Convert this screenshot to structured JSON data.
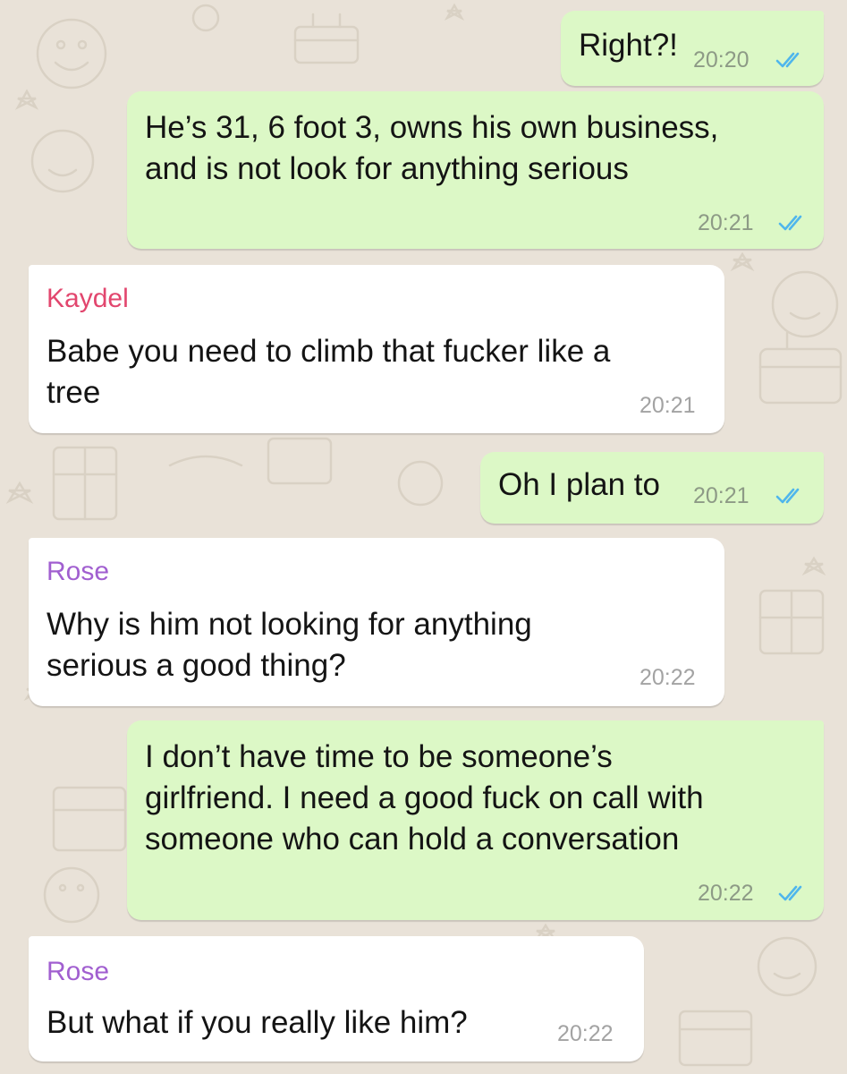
{
  "colors": {
    "background": "#e9e2d8",
    "outgoing_bubble": "#dcf8c6",
    "incoming_bubble": "#ffffff",
    "read_ticks": "#4fb6ec",
    "sender_kaydel": "#e2466e",
    "sender_rose": "#a15fd0"
  },
  "messages": [
    {
      "direction": "out",
      "lines": [
        "Right?!"
      ],
      "time": "20:20",
      "status_icon": "double-check-icon"
    },
    {
      "direction": "out",
      "lines": [
        "He’s 31, 6 foot 3, owns his own business,",
        "and is not look for anything serious"
      ],
      "time": "20:21",
      "status_icon": "double-check-icon"
    },
    {
      "direction": "in",
      "sender": "Kaydel",
      "lines": [
        "Babe you need to climb that fucker like a",
        "tree"
      ],
      "time": "20:21"
    },
    {
      "direction": "out",
      "lines": [
        "Oh I plan to"
      ],
      "time": "20:21",
      "status_icon": "double-check-icon"
    },
    {
      "direction": "in",
      "sender": "Rose",
      "lines": [
        "Why is him not looking for anything",
        "serious a good thing?"
      ],
      "time": "20:22"
    },
    {
      "direction": "out",
      "lines": [
        "I don’t have time to be someone’s",
        "girlfriend. I need a good fuck on call with",
        "someone who can hold a conversation"
      ],
      "time": "20:22",
      "status_icon": "double-check-icon"
    },
    {
      "direction": "in",
      "sender": "Rose",
      "lines": [
        "But what if you really like him?"
      ],
      "time": "20:22"
    }
  ]
}
